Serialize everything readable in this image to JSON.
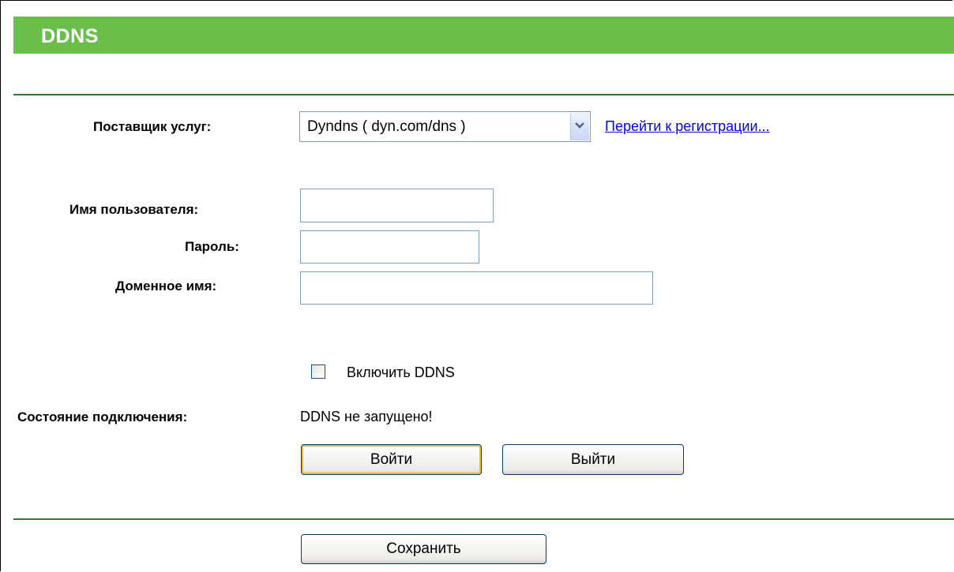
{
  "header": {
    "title": "DDNS"
  },
  "provider": {
    "label": "Поставщик услуг:",
    "selected": "Dyndns ( dyn.com/dns )",
    "register_link": "Перейти к регистрации..."
  },
  "fields": {
    "username_label": "Имя пользователя:",
    "username_value": "",
    "password_label": "Пароль:",
    "password_value": "",
    "domain_label": "Доменное имя:",
    "domain_value": ""
  },
  "enable_ddns": {
    "label": "Включить DDNS",
    "checked": false
  },
  "status": {
    "label": "Состояние подключения:",
    "value": "DDNS не запущено!"
  },
  "buttons": {
    "login": "Войти",
    "logout": "Выйти",
    "save": "Сохранить"
  }
}
